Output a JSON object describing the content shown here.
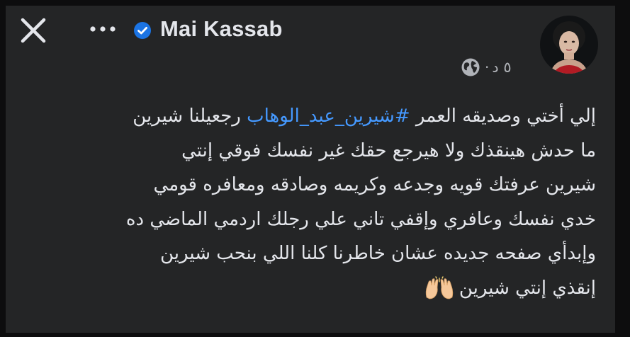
{
  "header": {
    "author_name": "Mai Kassab",
    "timestamp": "٥ د",
    "separator": "·",
    "verified_badge": "verified-icon",
    "privacy_icon": "globe-icon",
    "close_icon": "close-icon",
    "more_icon": "more-dots-icon"
  },
  "post": {
    "lines": [
      {
        "before": "إلي أختي وصديقه العمر ",
        "hashtag": "#شيرين_عبد_الوهاب",
        "after": " رجعيلنا شيرين"
      },
      {
        "text": "ما حدش هينقذك ولا هيرجع حقك غير نفسك فوقي إنتي"
      },
      {
        "text": "شيرين عرفتك قويه وجدعه وكريمه وصادقه ومعافره قومي"
      },
      {
        "text": "خدي نفسك وعافري وإقفي تاني علي رجلك اردمي الماضي ده"
      },
      {
        "text": "وإبدأي صفحه جديده عشان خاطرنا كلنا اللي بنحب شيرين"
      },
      {
        "text": "إنقذي إنتي شيرين",
        "emoji": "raising-hands-emoji"
      }
    ]
  },
  "colors": {
    "background": "#242526",
    "text": "#e4e6eb",
    "secondary_text": "#b0b3b8",
    "link": "#4599ff",
    "verified": "#1b74e4"
  }
}
